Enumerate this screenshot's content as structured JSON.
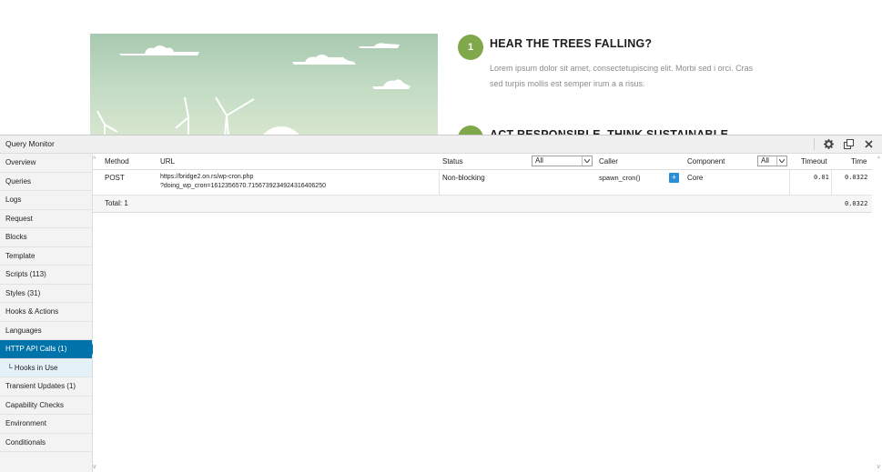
{
  "site": {
    "steps": [
      {
        "num": "1",
        "title": "HEAR THE TREES FALLING?",
        "text": "Lorem ipsum dolor sit amet, consectetupiscing elit. Morbi sed i orci. Cras sed turpis mollis est semper irum a a risus."
      },
      {
        "num": "",
        "title": "ACT RESPONSIBLE, THINK SUSTAINABLE",
        "text": ""
      }
    ]
  },
  "panel": {
    "title": "Query Monitor",
    "icons": [
      "gear-icon",
      "popout-icon",
      "close-icon"
    ]
  },
  "nav": {
    "items": [
      {
        "label": "Overview"
      },
      {
        "label": "Queries"
      },
      {
        "label": "Logs"
      },
      {
        "label": "Request"
      },
      {
        "label": "Blocks"
      },
      {
        "label": "Template"
      },
      {
        "label": "Scripts (113)"
      },
      {
        "label": "Styles (31)"
      },
      {
        "label": "Hooks & Actions"
      },
      {
        "label": "Languages"
      },
      {
        "label": "HTTP API Calls (1)"
      },
      {
        "label": "└ Hooks in Use"
      },
      {
        "label": "Transient Updates (1)"
      },
      {
        "label": "Capability Checks"
      },
      {
        "label": "Environment"
      },
      {
        "label": "Conditionals"
      }
    ],
    "active_index": 10
  },
  "table": {
    "headers": {
      "method": "Method",
      "url": "URL",
      "status": "Status",
      "caller": "Caller",
      "component": "Component",
      "timeout": "Timeout",
      "time": "Time"
    },
    "filters": {
      "status": "All",
      "component": "All"
    },
    "rows": [
      {
        "method": "POST",
        "url_line1": "https://bridge2.on.rs/wp-cron.php",
        "url_line2": "?doing_wp_cron=1612356570.7156739234924316406250",
        "status": "Non-blocking",
        "caller": "spawn_cron()",
        "expand": "+",
        "component": "Core",
        "timeout": "0.01",
        "time": "0.0322"
      }
    ],
    "total_label": "Total: 1",
    "total_time": "0.0322"
  }
}
